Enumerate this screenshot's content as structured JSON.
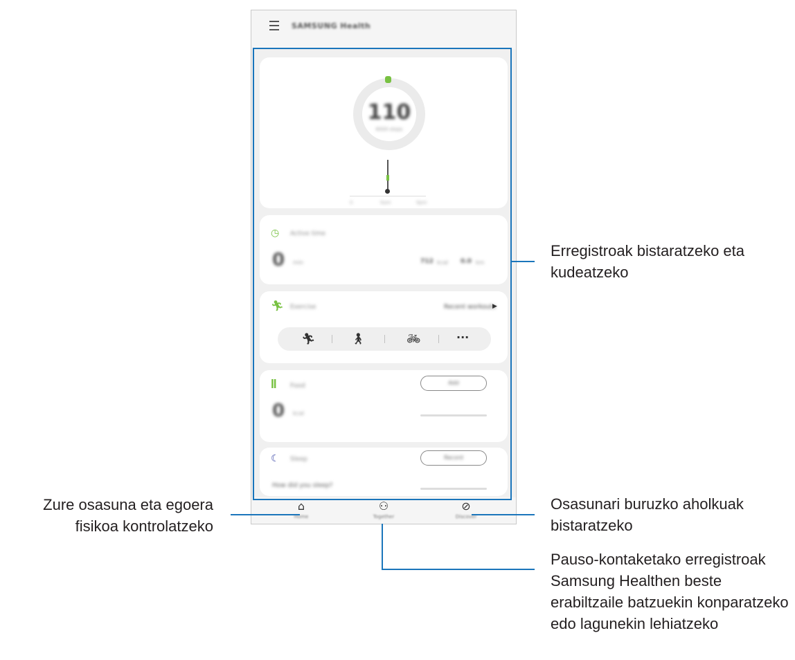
{
  "app": {
    "title": "SAMSUNG Health",
    "menu_icon": "hamburger-menu-icon"
  },
  "steps_card": {
    "steps_value": "110",
    "steps_caption": "6000 steps",
    "axis_ticks": [
      "0",
      "9am",
      "9pm"
    ]
  },
  "active_card": {
    "icon": "timer-icon",
    "title": "Active time",
    "value": "0",
    "unit": "min",
    "kcal_value": "712",
    "kcal_unit": "kcal",
    "km_value": "0.0",
    "km_unit": "km"
  },
  "exercise_card": {
    "icon": "running-icon",
    "title": "Exercise",
    "recent_link": "Recent workouts",
    "quick_start": [
      "running-icon",
      "walking-icon",
      "cycling-icon",
      "more-icon"
    ]
  },
  "food_card": {
    "icon": "fork-knife-icon",
    "title": "Food",
    "button": "Add",
    "value": "0",
    "unit": "kcal"
  },
  "sleep_card": {
    "icon": "moon-icon",
    "title": "Sleep",
    "button": "Record",
    "question": "How did you sleep?"
  },
  "bottom_nav": [
    {
      "icon": "home-icon",
      "label": "Home"
    },
    {
      "icon": "people-icon",
      "label": "Together"
    },
    {
      "icon": "compass-icon",
      "label": "Discover"
    }
  ],
  "callouts": {
    "records": "Erregistroak bistaratzeko eta kudeatzeko",
    "home": "Zure osasuna eta egoera fisikoa kontrolatzeko",
    "discover": "Osasunari buruzko aholkuak bistaratzeko",
    "together": "Pauso-kontaketako erregistroak Samsung Healthen beste erabiltzaile batzuekin konparatzeko edo lagunekin lehiatzeko"
  },
  "colors": {
    "accent_line": "#1a75bb",
    "progress_green": "#78c142"
  }
}
